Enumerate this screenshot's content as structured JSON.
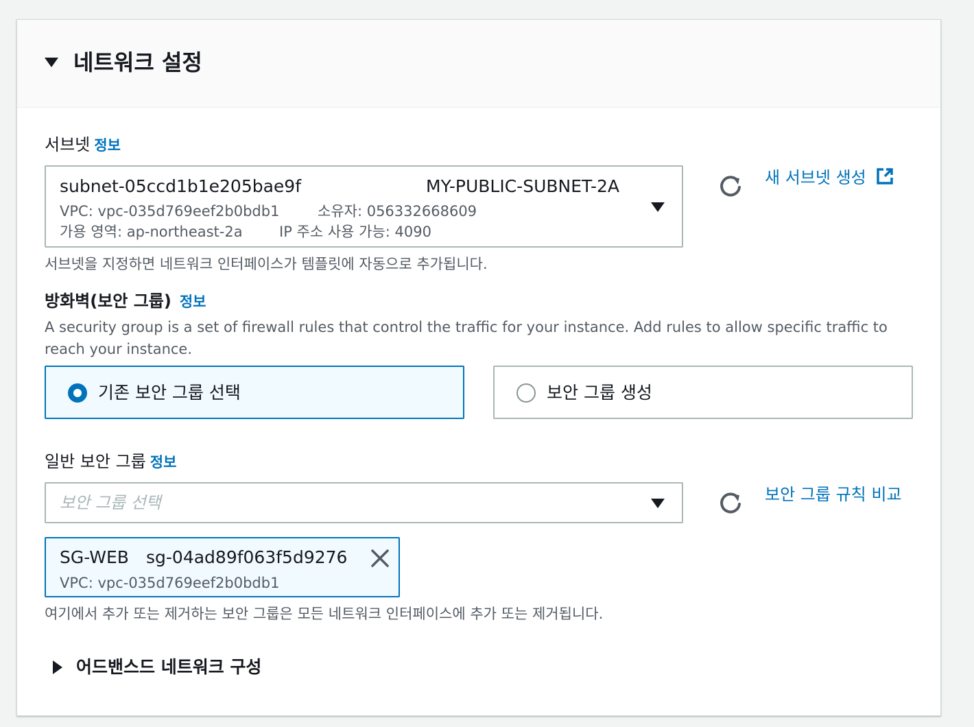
{
  "section": {
    "title": "네트워크 설정"
  },
  "subnet": {
    "label": "서브넷",
    "info": "정보",
    "selected": {
      "id": "subnet-05ccd1b1e205bae9f",
      "name": "MY-PUBLIC-SUBNET-2A",
      "vpc": "VPC: vpc-035d769eef2b0bdb1",
      "owner": "소유자: 056332668609",
      "az": "가용 영역: ap-northeast-2a",
      "ip_available": "IP 주소 사용 가능: 4090"
    },
    "create_link": "새 서브넷 생성",
    "hint": "서브넷을 지정하면 네트워크 인터페이스가 템플릿에 자동으로 추가됩니다."
  },
  "firewall": {
    "label": "방화벽(보안 그룹)",
    "info": "정보",
    "description_line1": "A security group is a set of firewall rules that control the traffic for your instance. Add rules to allow specific traffic to",
    "description_line2": "reach your instance.",
    "options": {
      "existing": "기존 보안 그룹 선택",
      "create": "보안 그룹 생성"
    },
    "selected_option": "existing"
  },
  "security_groups": {
    "label": "일반 보안 그룹",
    "info": "정보",
    "placeholder": "보안 그룹 선택",
    "compare_link": "보안 그룹 규칙 비교",
    "token": {
      "name": "SG-WEB",
      "id": "sg-04ad89f063f5d9276",
      "vpc": "VPC: vpc-035d769eef2b0bdb1"
    },
    "hint": "여기에서 추가 또는 제거하는 보안 그룹은 모든 네트워크 인터페이스에 추가 또는 제거됩니다."
  },
  "advanced": {
    "label": "어드밴스드 네트워크 구성"
  },
  "colors": {
    "link": "#0073bb",
    "border": "#aab7b8",
    "selected_bg": "#f1faff"
  }
}
